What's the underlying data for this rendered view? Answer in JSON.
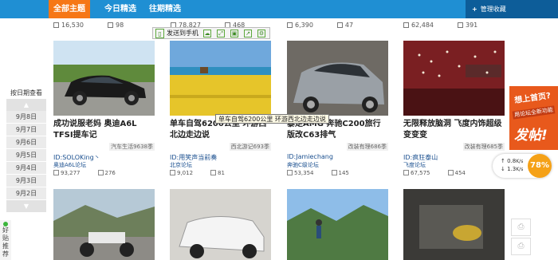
{
  "nav": {
    "tabs": [
      "全部主题",
      "今日精选",
      "往期精选"
    ],
    "manage_label": "管理收藏",
    "manage_plus": "+"
  },
  "prev_row": [
    {
      "views": "16,530",
      "replies": "98"
    },
    {
      "views": "78,827",
      "replies": "468"
    },
    {
      "views": "6,390",
      "replies": "47"
    },
    {
      "views": "62,484",
      "replies": "391"
    }
  ],
  "toolbar": {
    "send_to_phone": "发送到手机"
  },
  "date_rail": {
    "heading": "按日期查看",
    "dates": [
      "9月8日",
      "9月7日",
      "9月6日",
      "9月5日",
      "9月4日",
      "9月3日",
      "9月2日"
    ]
  },
  "recommend_label": "好贴推荐",
  "tooltip": "单车自驾6200公里 环游西北边走边说",
  "cards": [
    {
      "title": "成功说服老妈 奥迪A6L TFSI提车记",
      "category": "汽车生活9638季",
      "uid": "ID:SOLOKing丶",
      "forum": "奥迪A6L论坛",
      "views": "93,277",
      "replies": "276"
    },
    {
      "title": "单车自驾6200公里 环游西北边走边说",
      "category": "西北游记693季",
      "uid": "ID:用笑声当前奏",
      "forum": "北京论坛",
      "views": "9,012",
      "replies": "81"
    },
    {
      "title": "暴走AMG 奔驰C200旅行版改C63排气",
      "category": "改装有理686季",
      "uid": "ID:Jamiechang",
      "forum": "奔驰C级论坛",
      "views": "53,354",
      "replies": "145"
    },
    {
      "title": "无限释放脑洞 飞度内饰超级变变变",
      "category": "改装有理685季",
      "uid": "ID:疯狂泰山",
      "forum": "飞度论坛",
      "views": "67,575",
      "replies": "454"
    }
  ],
  "ad": {
    "line1": "想上首页?",
    "line2": "用论坛全新功能",
    "line3": "发帖!"
  },
  "speed": {
    "up": "0.8",
    "up_unit": "K/s",
    "down": "1.3",
    "down_unit": "K/s",
    "percent": "78%"
  },
  "side_buttons": [
    "⎙",
    "⎙"
  ]
}
